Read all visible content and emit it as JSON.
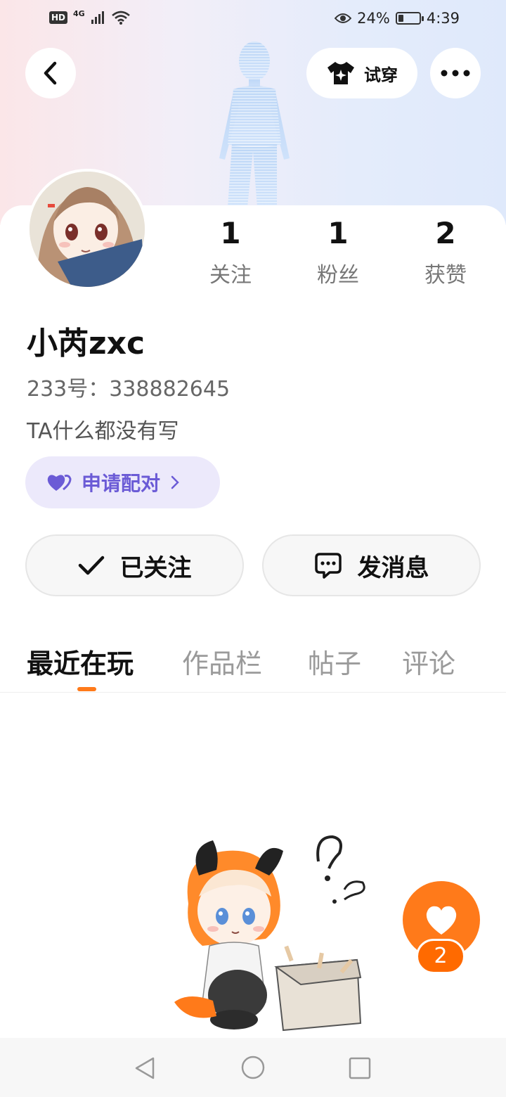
{
  "status_bar": {
    "hd_label": "HD",
    "network_label": "4G",
    "battery_percent": "24%",
    "battery_level": 0.24,
    "time": "4:39"
  },
  "header": {
    "try_on_label": "试穿"
  },
  "profile": {
    "nickname": "小芮zxc",
    "uid": "233号：338882645",
    "bio": "TA什么都没有写",
    "pair_label": "申请配对",
    "stats": [
      {
        "value": "1",
        "label": "关注"
      },
      {
        "value": "1",
        "label": "粉丝"
      },
      {
        "value": "2",
        "label": "获赞"
      }
    ]
  },
  "actions": {
    "followed_label": "已关注",
    "message_label": "发消息"
  },
  "tabs": [
    {
      "label": "最近在玩",
      "active": true
    },
    {
      "label": "作品栏",
      "active": false
    },
    {
      "label": "帖子",
      "active": false
    },
    {
      "label": "评论",
      "active": false
    }
  ],
  "like_fab": {
    "count": "2"
  },
  "colors": {
    "accent": "#ff7a1a",
    "pair_text": "#6b5bd6",
    "pair_bg": "#ece9fb"
  }
}
